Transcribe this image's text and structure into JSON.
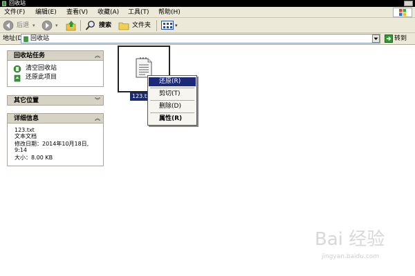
{
  "window": {
    "title": "回收站"
  },
  "menu": {
    "items": [
      "文件(F)",
      "编辑(E)",
      "查看(V)",
      "收藏(A)",
      "工具(T)",
      "帮助(H)"
    ]
  },
  "toolbar": {
    "back_label": "后退",
    "search_label": "搜索",
    "folders_label": "文件夹"
  },
  "address": {
    "label": "地址(D)",
    "value": "回收站",
    "go_label": "转到"
  },
  "tasks_panel": {
    "title": "回收站任务",
    "items": [
      "清空回收站",
      "还原此项目"
    ]
  },
  "other_places": {
    "title": "其它位置"
  },
  "details": {
    "title": "详细信息",
    "name": "123.txt",
    "type": "文本文档",
    "modified_label": "修改日期：2014年10月18日,",
    "modified_time": "9:14",
    "size": "大小：8.00 KB"
  },
  "file": {
    "label": "123.txt"
  },
  "context_menu": {
    "items": [
      "还原(R)",
      "剪切(T)",
      "删除(D)",
      "属性(R)"
    ]
  },
  "watermark": {
    "brand": "Bai 经验",
    "url": "jingyan.baidu.com"
  }
}
